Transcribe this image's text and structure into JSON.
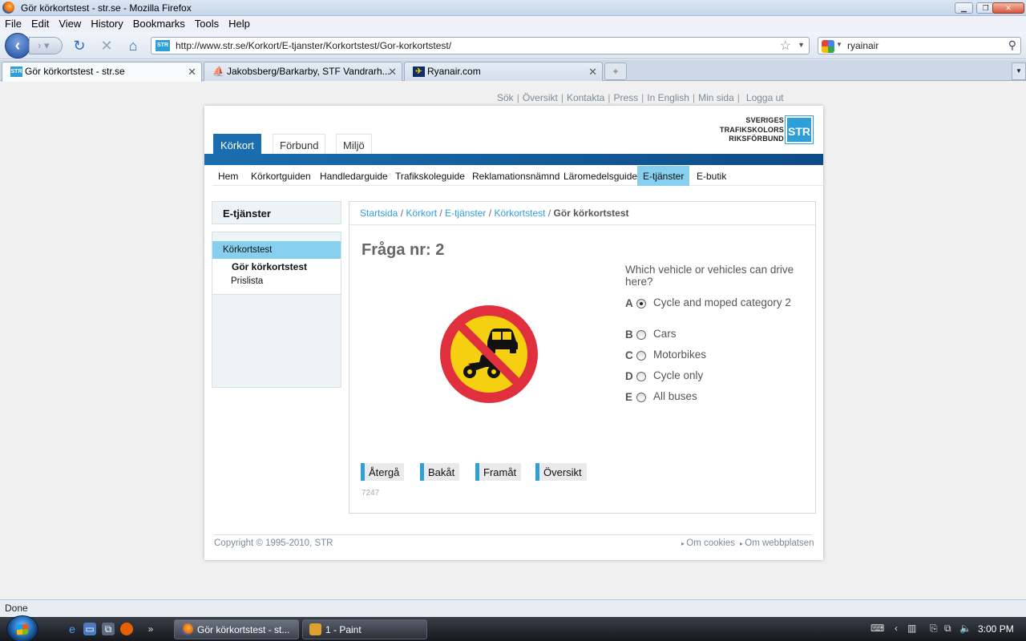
{
  "window": {
    "title": "Gör körkortstest - str.se - Mozilla Firefox"
  },
  "menu": [
    "File",
    "Edit",
    "View",
    "History",
    "Bookmarks",
    "Tools",
    "Help"
  ],
  "navbar": {
    "url": "http://www.str.se/Korkort/E-tjanster/Korkortstest/Gor-korkortstest/",
    "search_value": "ryainair"
  },
  "tabs": [
    {
      "label": "Gör körkortstest - str.se",
      "active": true
    },
    {
      "label": "Jakobsberg/Barkarby, STF Vandrarh...",
      "active": false
    },
    {
      "label": "Ryanair.com",
      "active": false
    }
  ],
  "toplinks": [
    "Sök",
    "Översikt",
    "Kontakta",
    "Press",
    "In English",
    "Min sida",
    "Logga ut"
  ],
  "maintabs": [
    "Körkort",
    "Förbund",
    "Miljö"
  ],
  "logo": {
    "line1": "SVERIGES",
    "line2": "TRAFIKSKOLORS",
    "line3": "RIKSFÖRBUND",
    "badge": "STR"
  },
  "subnav": [
    "Hem",
    "Körkortguiden",
    "Handledarguide",
    "Trafikskoleguide",
    "Reklamationsnämnd",
    "Läromedelsguide",
    "E-tjänster",
    "E-butik"
  ],
  "sidebar": {
    "heading": "E-tjänster",
    "selected": "Körkortstest",
    "items": [
      "Gör körkortstest",
      "Prislista"
    ]
  },
  "breadcrumb": {
    "items": [
      "Startsida",
      "Körkort",
      "E-tjänster",
      "Körkortstest"
    ],
    "current": "Gör körkortstest"
  },
  "quiz": {
    "title": "Fråga nr: 2",
    "question": "Which vehicle or vehicles can drive here?",
    "options": [
      {
        "letter": "A",
        "label": "Cycle and moped category 2",
        "selected": true
      },
      {
        "letter": "B",
        "label": "Cars",
        "selected": false
      },
      {
        "letter": "C",
        "label": "Motorbikes",
        "selected": false
      },
      {
        "letter": "D",
        "label": "Cycle only",
        "selected": false
      },
      {
        "letter": "E",
        "label": "All buses",
        "selected": false
      }
    ],
    "buttons": [
      "Återgå",
      "Bakåt",
      "Framåt",
      "Översikt"
    ],
    "id": "7247"
  },
  "footer": {
    "copyright": "Copyright © 1995-2010, STR",
    "links": [
      "Om cookies",
      "Om webbplatsen"
    ]
  },
  "status": "Done",
  "taskbar": {
    "windows": [
      {
        "label": "Gör körkortstest - st...",
        "active": true
      },
      {
        "label": "1 - Paint",
        "active": false
      }
    ],
    "clock": "3:00 PM"
  },
  "colors": {
    "accent": "#2e9fd7",
    "brand_blue": "#1a6eb0",
    "highlight": "#86cfee",
    "sign_red": "#e0303e",
    "sign_yellow": "#f5d010"
  }
}
